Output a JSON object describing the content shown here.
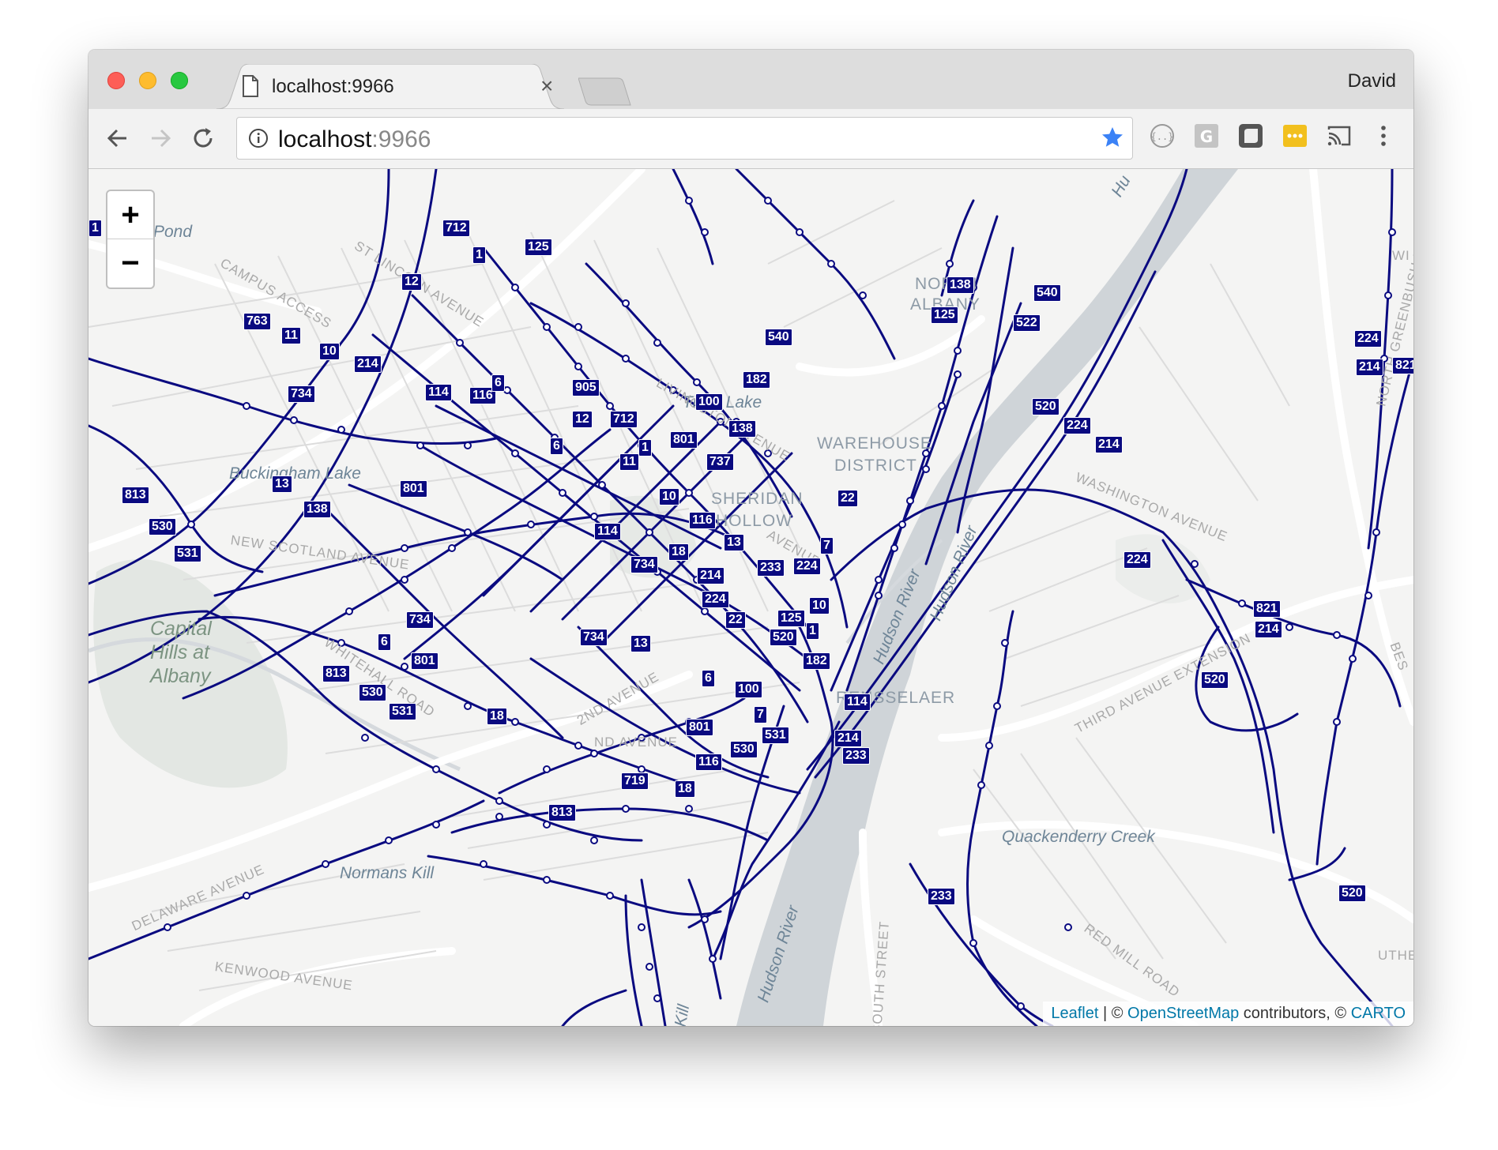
{
  "browser": {
    "tab_title": "localhost:9966",
    "tab_close": "×",
    "profile_name": "David",
    "url_host": "localhost",
    "url_port": ":9966"
  },
  "map": {
    "zoom_in": "+",
    "zoom_out": "−",
    "attribution": {
      "leaflet": "Leaflet",
      "sep1": " | © ",
      "osm": "OpenStreetMap",
      "contributors": " contributors, © ",
      "carto": "CARTO"
    },
    "places": {
      "north_albany_1": "NORTH",
      "north_albany_2": "ALBANY",
      "warehouse_1": "WAREHOUSE",
      "warehouse_2": "DISTRICT",
      "sheridan_1": "SHERIDAN",
      "sheridan_2": "HOLLOW",
      "rensselaer": "RENSSELAER",
      "capital_1": "Capital",
      "capital_2": "Hills at",
      "capital_3": "Albany"
    },
    "water": {
      "pond": "Pond",
      "tivoli": "Tivoli Lake",
      "buckingham": "Buckingham Lake",
      "normans": "Normans Kill",
      "quackenderry": "Quackenderry Creek",
      "hudson1": "Hudson River",
      "hudson2": "Hudson River",
      "hudson3": "Hudson River",
      "kill": "Kill",
      "hu": "Hu"
    },
    "streets": {
      "campus": "CAMPUS ACCESS",
      "lincoln": "ST LINCOLN AVENUE",
      "livingston": "LIVINGSTON AVENUE",
      "washington": "WASHINGTON AVENUE",
      "third": "THIRD AVENUE EXTENSION",
      "delaware": "DELAWARE AVENUE",
      "kenwood": "KENWOOD AVENUE",
      "red_mill": "RED MILL ROAD",
      "south": "SOUTH STREET",
      "greenbush": "NORTH GREENBUSH ROAD",
      "second": "2ND AVENUE",
      "new_scotland": "NEW SCOTLAND AVENUE",
      "whitehall": "WHITEHALL ROAD",
      "avenue": "AVENUE",
      "uther": "UTHER",
      "wi": "WI",
      "bes": "BES",
      "und_avenue": "ND AVENUE"
    },
    "routes": [
      {
        "label": "712"
      },
      {
        "label": "1"
      },
      {
        "label": "125"
      },
      {
        "label": "12"
      },
      {
        "label": "763"
      },
      {
        "label": "11"
      },
      {
        "label": "10"
      },
      {
        "label": "214"
      },
      {
        "label": "734"
      },
      {
        "label": "114"
      },
      {
        "label": "116"
      },
      {
        "label": "6"
      },
      {
        "label": "905"
      },
      {
        "label": "12"
      },
      {
        "label": "712"
      },
      {
        "label": "100"
      },
      {
        "label": "182"
      },
      {
        "label": "540"
      },
      {
        "label": "138"
      },
      {
        "label": "801"
      },
      {
        "label": "1"
      },
      {
        "label": "11"
      },
      {
        "label": "737"
      },
      {
        "label": "6"
      },
      {
        "label": "813"
      },
      {
        "label": "13"
      },
      {
        "label": "138"
      },
      {
        "label": "801"
      },
      {
        "label": "530"
      },
      {
        "label": "531"
      },
      {
        "label": "10"
      },
      {
        "label": "116"
      },
      {
        "label": "114"
      },
      {
        "label": "18"
      },
      {
        "label": "13"
      },
      {
        "label": "734"
      },
      {
        "label": "214"
      },
      {
        "label": "233"
      },
      {
        "label": "224"
      },
      {
        "label": "7"
      },
      {
        "label": "22"
      },
      {
        "label": "224"
      },
      {
        "label": "22"
      },
      {
        "label": "125"
      },
      {
        "label": "10"
      },
      {
        "label": "520"
      },
      {
        "label": "1"
      },
      {
        "label": "182"
      },
      {
        "label": "734"
      },
      {
        "label": "734"
      },
      {
        "label": "13"
      },
      {
        "label": "6"
      },
      {
        "label": "801"
      },
      {
        "label": "813"
      },
      {
        "label": "530"
      },
      {
        "label": "531"
      },
      {
        "label": "18"
      },
      {
        "label": "6"
      },
      {
        "label": "100"
      },
      {
        "label": "7"
      },
      {
        "label": "801"
      },
      {
        "label": "531"
      },
      {
        "label": "530"
      },
      {
        "label": "116"
      },
      {
        "label": "719"
      },
      {
        "label": "18"
      },
      {
        "label": "813"
      },
      {
        "label": "114"
      },
      {
        "label": "214"
      },
      {
        "label": "233"
      },
      {
        "label": "233"
      },
      {
        "label": "138"
      },
      {
        "label": "125"
      },
      {
        "label": "540"
      },
      {
        "label": "522"
      },
      {
        "label": "520"
      },
      {
        "label": "224"
      },
      {
        "label": "214"
      },
      {
        "label": "224"
      },
      {
        "label": "821"
      },
      {
        "label": "214"
      },
      {
        "label": "520"
      },
      {
        "label": "520"
      },
      {
        "label": "224"
      },
      {
        "label": "214"
      },
      {
        "label": "821"
      },
      {
        "label": "1"
      }
    ],
    "colors": {
      "route_line": "#0a0a80",
      "water": "#cfd4d8",
      "land": "#f4f4f3",
      "road": "#ffffff"
    }
  }
}
